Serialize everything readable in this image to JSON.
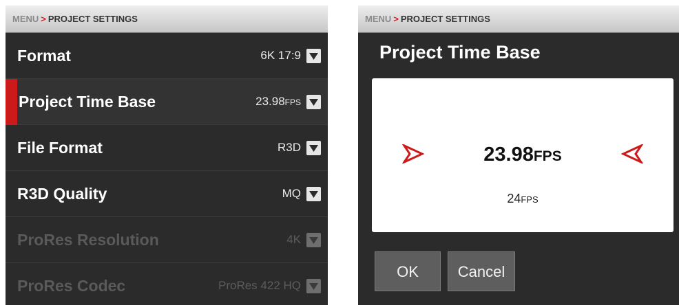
{
  "breadcrumb": {
    "root": "MENU",
    "separator": ">",
    "current": "PROJECT SETTINGS"
  },
  "settings": [
    {
      "label": "Format",
      "value": "6K 17:9",
      "unit": "",
      "state": "enabled"
    },
    {
      "label": "Project Time Base",
      "value": "23.98",
      "unit": "FPS",
      "state": "selected"
    },
    {
      "label": "File Format",
      "value": "R3D",
      "unit": "",
      "state": "enabled"
    },
    {
      "label": "R3D Quality",
      "value": "MQ",
      "unit": "",
      "state": "enabled"
    },
    {
      "label": "ProRes Resolution",
      "value": "4K",
      "unit": "",
      "state": "disabled"
    },
    {
      "label": "ProRes Codec",
      "value": "ProRes 422 HQ",
      "unit": "",
      "state": "disabled"
    }
  ],
  "dialog": {
    "title": "Project Time Base",
    "current_value": "23.98",
    "current_unit": "FPS",
    "next_value": "24",
    "next_unit": "FPS",
    "ok_label": "OK",
    "cancel_label": "Cancel"
  },
  "icons": {
    "dropdown": "chevron-down-icon",
    "prev": "arrow-right-icon",
    "next": "arrow-left-icon"
  },
  "colors": {
    "accent": "#cc1a1a",
    "panel_bg": "#2b2b2b",
    "text": "#ffffff",
    "disabled_text": "#5a5a5a"
  }
}
